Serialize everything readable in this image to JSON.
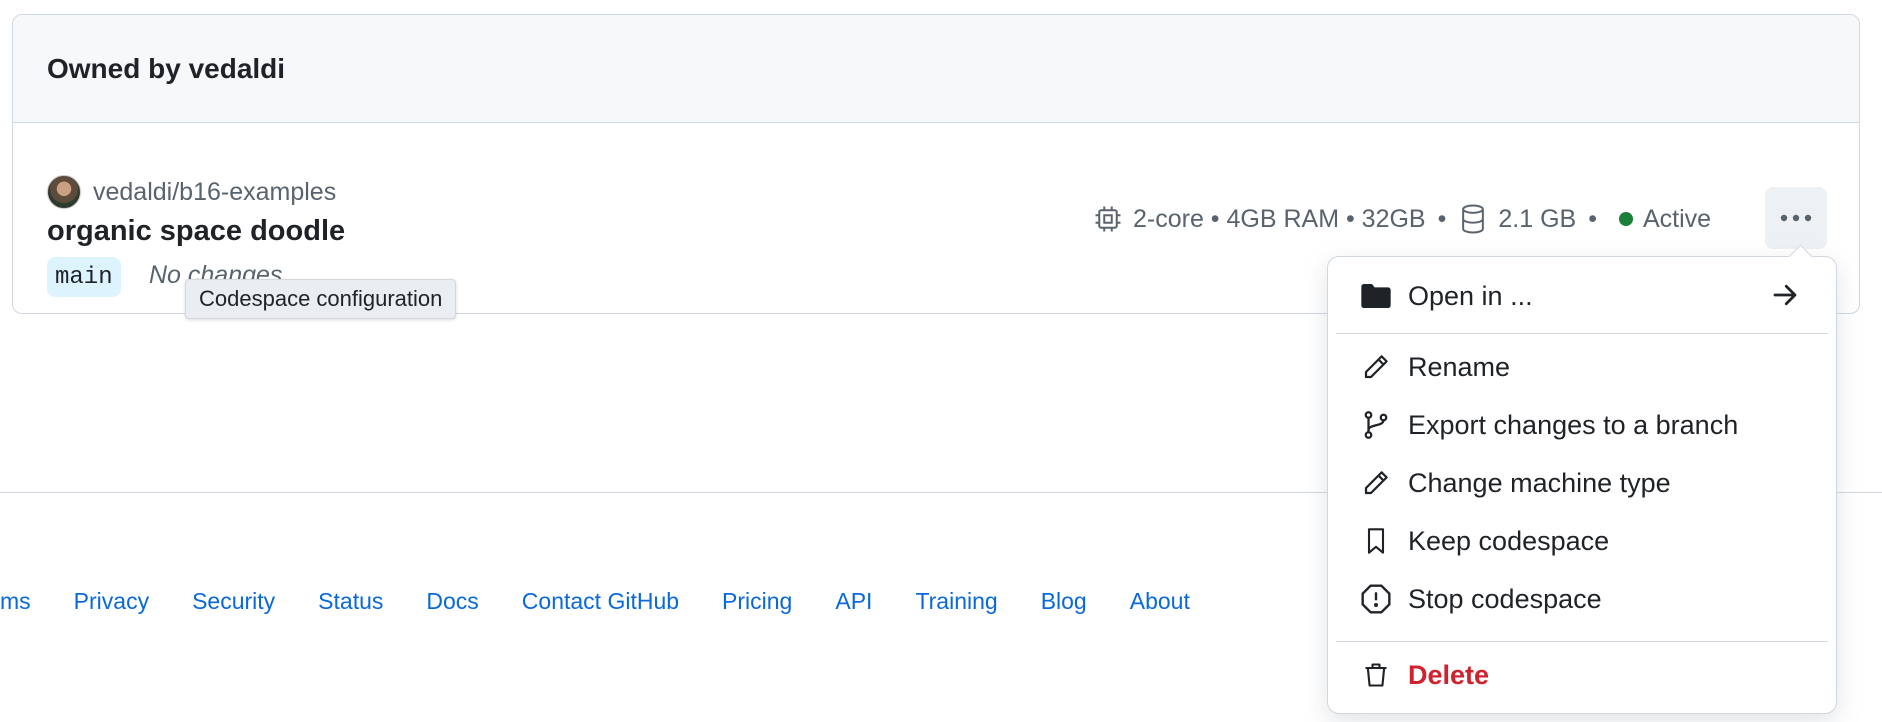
{
  "section": {
    "title": "Owned by vedaldi"
  },
  "codespace": {
    "repo": "vedaldi/b16-examples",
    "name": "organic space doodle",
    "branch": "main",
    "changes": "No changes",
    "machine": "2-core • 4GB RAM • 32GB",
    "storage": "2.1 GB",
    "status": "Active",
    "status_color": "#1a7f37"
  },
  "tooltip": {
    "text": "Codespace configuration"
  },
  "menu": {
    "items": [
      {
        "label": "Open in ...",
        "icon": "folder-icon"
      },
      {
        "label": "Rename",
        "icon": "pencil-icon"
      },
      {
        "label": "Export changes to a branch",
        "icon": "git-branch-icon"
      },
      {
        "label": "Change machine type",
        "icon": "pencil-icon"
      },
      {
        "label": "Keep codespace",
        "icon": "bookmark-icon"
      },
      {
        "label": "Stop codespace",
        "icon": "stop-icon"
      },
      {
        "label": "Delete",
        "icon": "trash-icon"
      }
    ]
  },
  "footer": {
    "links": [
      "ms",
      "Privacy",
      "Security",
      "Status",
      "Docs",
      "Contact GitHub",
      "Pricing",
      "API",
      "Training",
      "Blog",
      "About"
    ]
  },
  "colors": {
    "link": "#0969da",
    "danger": "#cf222e",
    "branch_bg": "#ddf4ff"
  }
}
